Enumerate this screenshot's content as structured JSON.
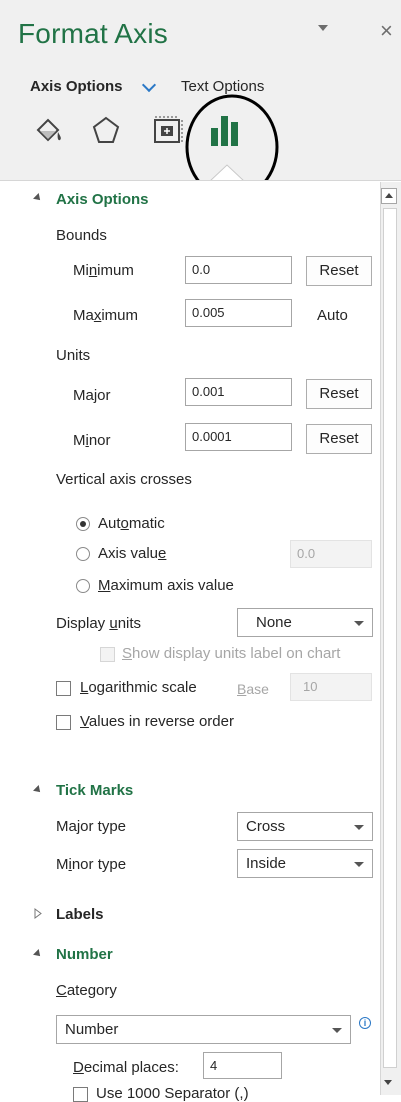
{
  "pane": {
    "title": "Format Axis",
    "close_glyph": "×"
  },
  "tabs": {
    "axis_options": "Axis Options",
    "text_options": "Text Options"
  },
  "icons": [
    "fill-line-icon",
    "effects-icon",
    "size-properties-icon",
    "axis-options-icon"
  ],
  "colors": {
    "accent": "#217346",
    "link": "#2b78c6",
    "annotation": "#000000"
  },
  "sections": {
    "axis_options": "Axis Options",
    "tick_marks": "Tick Marks",
    "labels": "Labels",
    "number": "Number"
  },
  "bounds": {
    "label": "Bounds",
    "minimum": {
      "label_pre": "Mi",
      "label_u": "n",
      "label_post": "imum",
      "value": "0.0",
      "button": "Reset"
    },
    "maximum": {
      "label_pre": "Ma",
      "label_u": "x",
      "label_post": "imum",
      "value": "0.005",
      "button": "Auto"
    }
  },
  "units": {
    "label": "Units",
    "major": {
      "label": "Major",
      "value": "0.001",
      "button": "Reset"
    },
    "minor": {
      "label_pre": "M",
      "label_u": "i",
      "label_post": "nor",
      "value": "0.0001",
      "button": "Reset"
    }
  },
  "crosses": {
    "label": "Vertical axis crosses",
    "automatic": {
      "pre": "Aut",
      "u": "o",
      "post": "matic",
      "selected": true
    },
    "axis_value": {
      "pre": "Axis valu",
      "u": "e",
      "post": "",
      "value": "0.0"
    },
    "maximum": {
      "pre": "",
      "u": "M",
      "post": "aximum axis value"
    }
  },
  "display_units": {
    "label_pre": "Display ",
    "label_u": "u",
    "label_post": "nits",
    "value": "None",
    "show_label": {
      "pre": "",
      "u": "S",
      "post": "how display units label on chart"
    }
  },
  "log_scale": {
    "pre": "",
    "u": "L",
    "post": "ogarithmic scale",
    "base_pre": "",
    "base_u": "B",
    "base_post": "ase",
    "base_value": "10"
  },
  "reverse": {
    "pre": "",
    "u": "V",
    "post": "alues in reverse order"
  },
  "tick_marks": {
    "major_label": "Major type",
    "major_value": "Cross",
    "minor_label_pre": "M",
    "minor_label_u": "i",
    "minor_label_post": "nor type",
    "minor_value": "Inside"
  },
  "number": {
    "category_pre": "",
    "category_u": "C",
    "category_post": "ategory",
    "category_value": "Number",
    "decimal_pre": "",
    "decimal_u": "D",
    "decimal_post": "ecimal places:",
    "decimal_value": "4",
    "separator_partial": "Use 1000 Separator (,)"
  }
}
